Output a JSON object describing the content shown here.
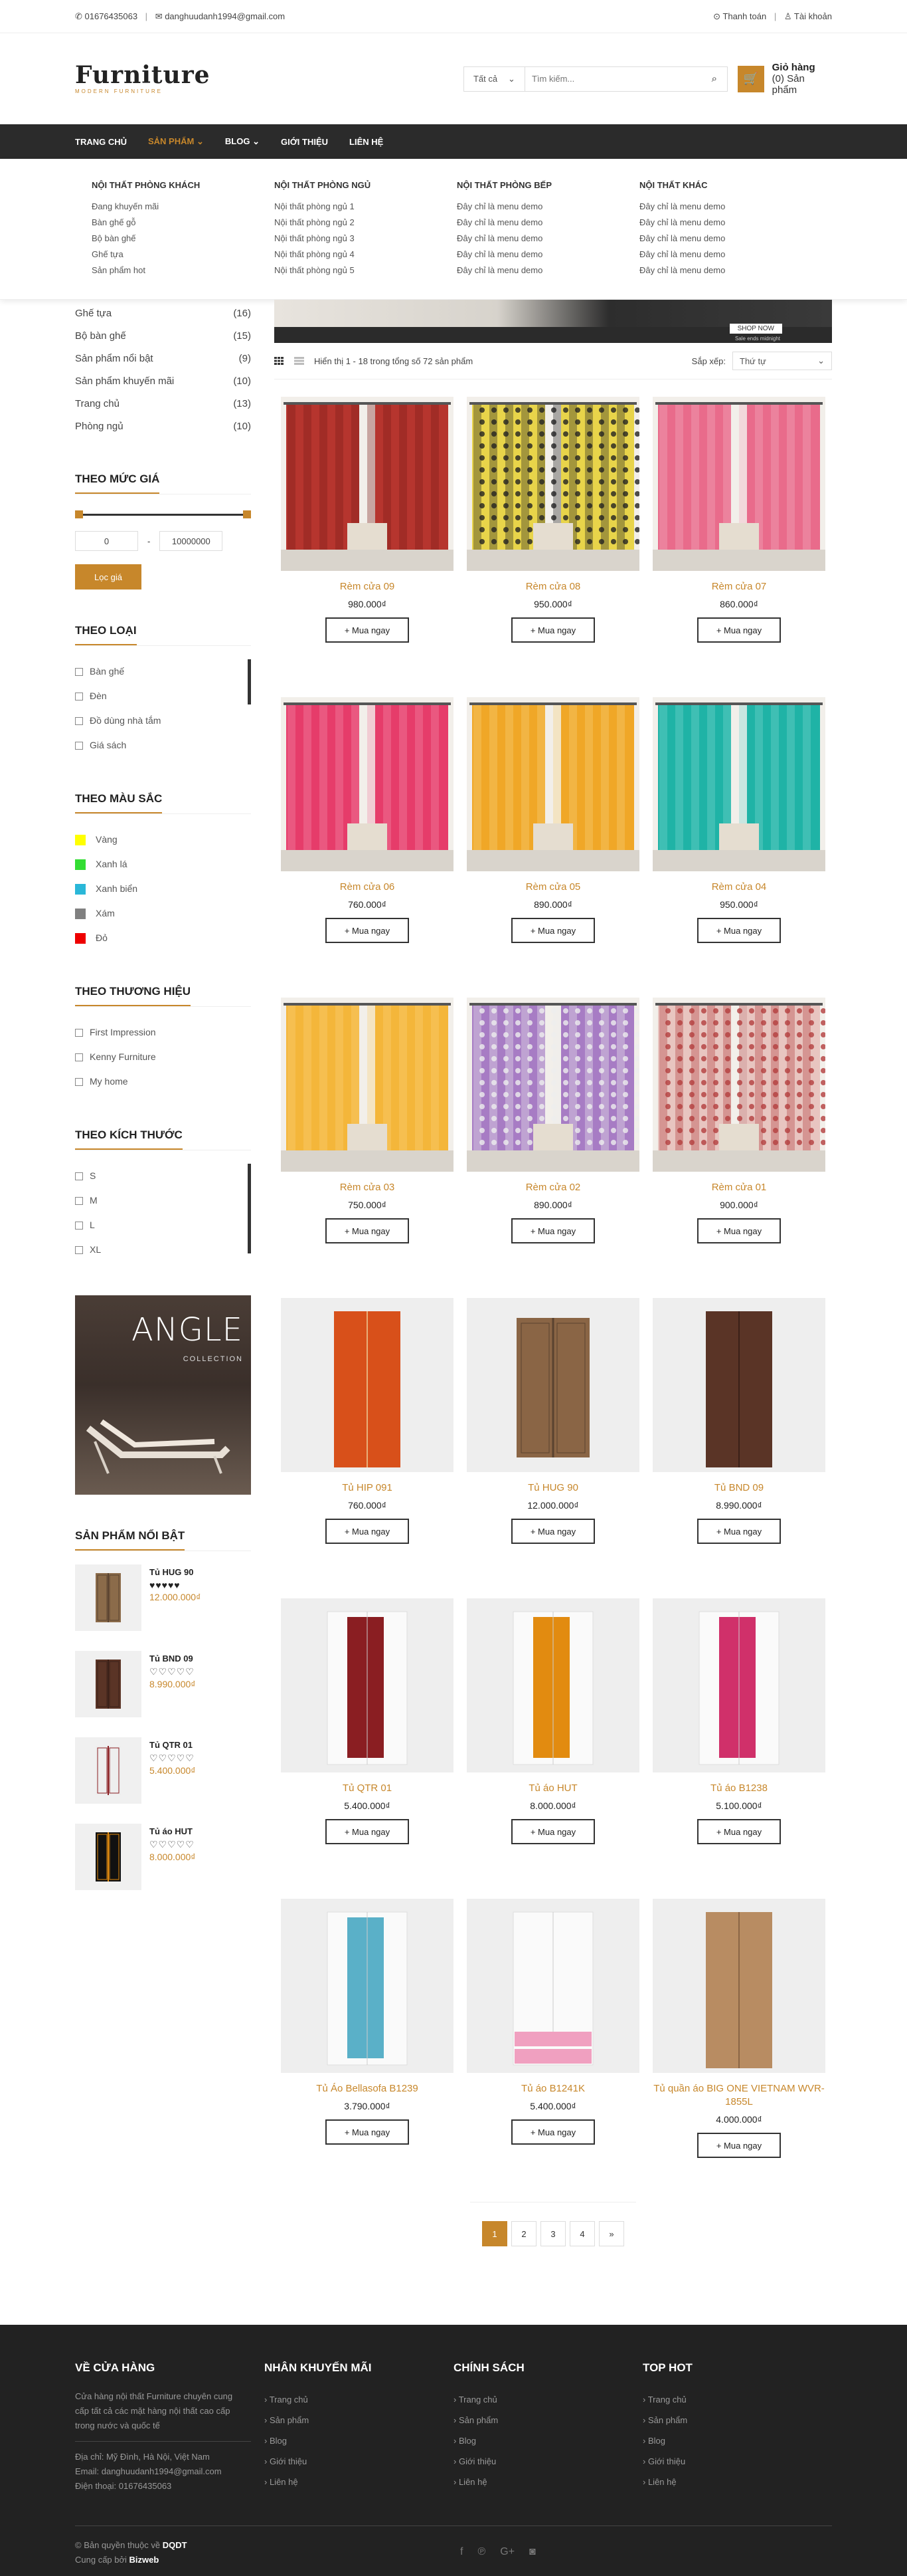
{
  "topbar": {
    "phone": "01676435063",
    "email": "danghuudanh1994@gmail.com",
    "checkout": "Thanh toán",
    "account": "Tài khoản"
  },
  "logo": {
    "name": "Furniture",
    "tagline": "MODERN FURNITURE"
  },
  "search": {
    "category": "Tất cả",
    "placeholder": "Tìm kiếm..."
  },
  "cart": {
    "title": "Giỏ hàng",
    "count": "(0) Sản phẩm"
  },
  "nav": [
    {
      "label": "TRANG CHỦ"
    },
    {
      "label": "SẢN PHẨM"
    },
    {
      "label": "BLOG"
    },
    {
      "label": "GIỚI THIỆU"
    },
    {
      "label": "LIÊN HỆ"
    }
  ],
  "mega": [
    {
      "title": "NỘI THẤT PHÒNG KHÁCH",
      "links": [
        "Đang khuyến mãi",
        "Bàn ghế gỗ",
        "Bộ bàn ghế",
        "Ghế tựa",
        "Sản phẩm hot"
      ]
    },
    {
      "title": "NỘI THẤT PHÒNG NGỦ",
      "links": [
        "Nội thất phòng ngủ 1",
        "Nội thất phòng ngủ 2",
        "Nội thất phòng ngủ 3",
        "Nội thất phòng ngủ 4",
        "Nội thất phòng ngủ 5"
      ]
    },
    {
      "title": "NỘI THẤT PHÒNG BẾP",
      "links": [
        "Đây chỉ là menu demo",
        "Đây chỉ là menu demo",
        "Đây chỉ là menu demo",
        "Đây chỉ là menu demo",
        "Đây chỉ là menu demo"
      ]
    },
    {
      "title": "NỘI THẤT KHÁC",
      "links": [
        "Đây chỉ là menu demo",
        "Đây chỉ là menu demo",
        "Đây chỉ là menu demo",
        "Đây chỉ là menu demo",
        "Đây chỉ là menu demo"
      ]
    }
  ],
  "categories": [
    {
      "name": "Ghế tựa",
      "count": "(16)"
    },
    {
      "name": "Bộ bàn ghế",
      "count": "(15)"
    },
    {
      "name": "Sản phẩm nổi bật",
      "count": "(9)"
    },
    {
      "name": "Sản phẩm khuyến mãi",
      "count": "(10)"
    },
    {
      "name": "Trang chủ",
      "count": "(13)"
    },
    {
      "name": "Phòng ngủ",
      "count": "(10)"
    }
  ],
  "price_filter": {
    "title": "THEO MỨC GIÁ",
    "min": "0",
    "sep": "-",
    "max": "10000000",
    "button": "Lọc giá"
  },
  "type_filter": {
    "title": "THEO LOẠI",
    "items": [
      "Bàn ghế",
      "Đèn",
      "Đồ dùng nhà tắm",
      "Giá sách"
    ]
  },
  "color_filter": {
    "title": "THEO MÀU SẮC",
    "items": [
      {
        "name": "Vàng",
        "color": "#ffff00"
      },
      {
        "name": "Xanh lá",
        "color": "#33dd33"
      },
      {
        "name": "Xanh biển",
        "color": "#2ab7d8"
      },
      {
        "name": "Xám",
        "color": "#808080"
      },
      {
        "name": "Đỏ",
        "color": "#ee0000"
      }
    ]
  },
  "brand_filter": {
    "title": "THEO THƯƠNG HIỆU",
    "items": [
      "First Impression",
      "Kenny Furniture",
      "My home"
    ]
  },
  "size_filter": {
    "title": "THEO KÍCH THƯỚC",
    "items": [
      "S",
      "M",
      "L",
      "XL"
    ]
  },
  "banner": {
    "title": "ANGLE",
    "subtitle": "COLLECTION"
  },
  "featured": {
    "title": "SẢN PHẨM NỔI BẬT",
    "items": [
      {
        "name": "Tủ HUG 90",
        "stars": "♥♥♥♥♥",
        "price": "12.000.000₫"
      },
      {
        "name": "Tủ BND 09",
        "stars": "♡♡♡♡♡",
        "price": "8.990.000₫"
      },
      {
        "name": "Tủ QTR 01",
        "stars": "♡♡♡♡♡",
        "price": "5.400.000₫"
      },
      {
        "name": "Tủ áo HUT",
        "stars": "♡♡♡♡♡",
        "price": "8.000.000₫"
      }
    ]
  },
  "hero": {
    "shop": "SHOP NOW",
    "ends": "Sale ends midnight"
  },
  "toolbar": {
    "count": "Hiển thị 1 - 18 trong tổng số 72 sản phẩm",
    "sort_label": "Sắp xếp:",
    "sort_value": "Thứ tự"
  },
  "buy_label": "+ Mua ngay",
  "products": [
    {
      "name": "Rèm cửa 09",
      "price": "980.000₫"
    },
    {
      "name": "Rèm cửa 08",
      "price": "950.000₫"
    },
    {
      "name": "Rèm cửa 07",
      "price": "860.000₫"
    },
    {
      "name": "Rèm cửa 06",
      "price": "760.000₫"
    },
    {
      "name": "Rèm cửa 05",
      "price": "890.000₫"
    },
    {
      "name": "Rèm cửa 04",
      "price": "950.000₫"
    },
    {
      "name": "Rèm cửa 03",
      "price": "750.000₫"
    },
    {
      "name": "Rèm cửa 02",
      "price": "890.000₫"
    },
    {
      "name": "Rèm cửa 01",
      "price": "900.000₫"
    },
    {
      "name": "Tủ HIP 091",
      "price": "760.000₫"
    },
    {
      "name": "Tủ HUG 90",
      "price": "12.000.000₫"
    },
    {
      "name": "Tủ BND 09",
      "price": "8.990.000₫"
    },
    {
      "name": "Tủ QTR 01",
      "price": "5.400.000₫"
    },
    {
      "name": "Tủ áo HUT",
      "price": "8.000.000₫"
    },
    {
      "name": "Tủ áo B1238",
      "price": "5.100.000₫"
    },
    {
      "name": "Tủ Áo Bellasofa B1239",
      "price": "3.790.000₫"
    },
    {
      "name": "Tủ áo B1241K",
      "price": "5.400.000₫"
    },
    {
      "name": "Tủ quần áo BIG ONE VIETNAM WVR-1855L",
      "price": "4.000.000₫"
    }
  ],
  "pagination": [
    "1",
    "2",
    "3",
    "4",
    "»"
  ],
  "footer": {
    "about": {
      "title": "VỀ CỬA HÀNG",
      "text": "Cửa hàng nội thất Furniture chuyên cung cấp tất cả các mặt hàng nội thất cao cấp trong nước và quốc tế",
      "address": "Địa chỉ: Mỹ Đình, Hà Nội, Việt Nam",
      "email": "Email: danghuudanh1994@gmail.com",
      "phone": "Điện thoại: 01676435063"
    },
    "cols": [
      {
        "title": "NHÂN KHUYẾN MÃI",
        "links": [
          "Trang chủ",
          "Sản phẩm",
          "Blog",
          "Giới thiệu",
          "Liên hệ"
        ]
      },
      {
        "title": "CHÍNH SÁCH",
        "links": [
          "Trang chủ",
          "Sản phẩm",
          "Blog",
          "Giới thiệu",
          "Liên hệ"
        ]
      },
      {
        "title": "TOP HOT",
        "links": [
          "Trang chủ",
          "Sản phẩm",
          "Blog",
          "Giới thiệu",
          "Liên hệ"
        ]
      }
    ],
    "copyright": "© Bản quyền thuộc về",
    "copyright_brand": "DQDT",
    "credit": "Cung cấp bởi",
    "credit_brand": "Bizweb"
  }
}
